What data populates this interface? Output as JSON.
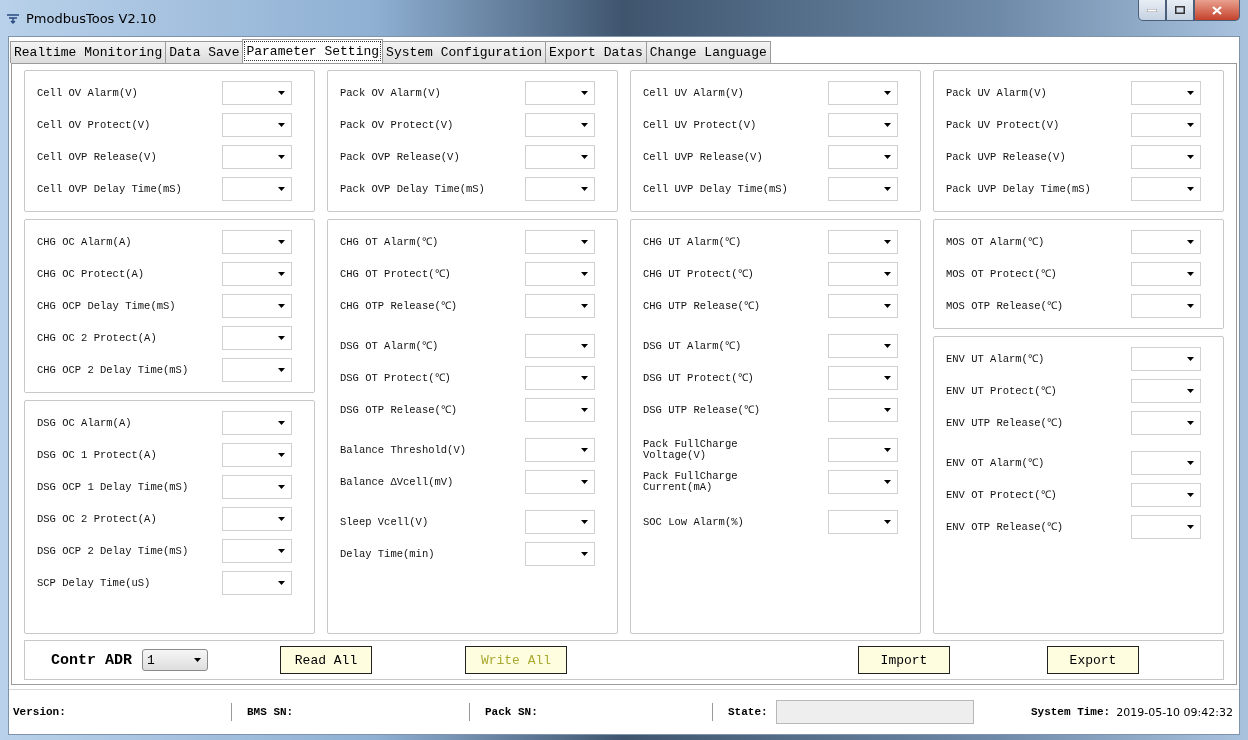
{
  "window": {
    "title": "PmodbusToos V2.10"
  },
  "tabs": [
    {
      "label": "Realtime Monitoring",
      "selected": false
    },
    {
      "label": "Data Save",
      "selected": false
    },
    {
      "label": "Parameter Setting",
      "selected": true
    },
    {
      "label": "System Configuration",
      "selected": false
    },
    {
      "label": "Export Datas",
      "selected": false
    },
    {
      "label": "Change Language",
      "selected": false
    }
  ],
  "columns": [
    {
      "groups": [
        {
          "sections": [
            [
              {
                "label": "Cell OV Alarm(V)"
              },
              {
                "label": "Cell OV Protect(V)"
              },
              {
                "label": "Cell OVP Release(V)"
              },
              {
                "label": "Cell OVP Delay Time(mS)"
              }
            ]
          ]
        },
        {
          "sections": [
            [
              {
                "label": "CHG OC Alarm(A)"
              },
              {
                "label": "CHG OC Protect(A)"
              },
              {
                "label": "CHG OCP Delay Time(mS)"
              },
              {
                "label": "CHG OC 2 Protect(A)"
              },
              {
                "label": "CHG OCP 2 Delay Time(mS)"
              }
            ]
          ]
        },
        {
          "sections": [
            [
              {
                "label": "DSG OC Alarm(A)"
              },
              {
                "label": "DSG OC 1 Protect(A)"
              },
              {
                "label": "DSG OCP 1 Delay Time(mS)"
              },
              {
                "label": "DSG OC 2 Protect(A)"
              },
              {
                "label": "DSG OCP 2 Delay Time(mS)"
              },
              {
                "label": "SCP Delay Time(uS)"
              }
            ]
          ]
        }
      ]
    },
    {
      "groups": [
        {
          "sections": [
            [
              {
                "label": "Pack OV Alarm(V)"
              },
              {
                "label": "Pack OV Protect(V)"
              },
              {
                "label": "Pack OVP Release(V)"
              },
              {
                "label": "Pack OVP Delay Time(mS)"
              }
            ]
          ]
        },
        {
          "sections": [
            [
              {
                "label": "CHG OT Alarm(℃)"
              },
              {
                "label": "CHG OT Protect(℃)"
              },
              {
                "label": "CHG OTP Release(℃)"
              }
            ],
            [
              {
                "label": "DSG OT Alarm(℃)"
              },
              {
                "label": "DSG OT Protect(℃)"
              },
              {
                "label": "DSG OTP Release(℃)"
              }
            ],
            [
              {
                "label": "Balance Threshold(V)"
              },
              {
                "label": "Balance ΔVcell(mV)"
              }
            ],
            [
              {
                "label": "Sleep Vcell(V)"
              },
              {
                "label": "Delay Time(min)"
              }
            ]
          ]
        }
      ]
    },
    {
      "groups": [
        {
          "sections": [
            [
              {
                "label": "Cell UV Alarm(V)"
              },
              {
                "label": "Cell UV Protect(V)"
              },
              {
                "label": "Cell UVP Release(V)"
              },
              {
                "label": "Cell UVP Delay Time(mS)"
              }
            ]
          ]
        },
        {
          "sections": [
            [
              {
                "label": "CHG UT Alarm(℃)"
              },
              {
                "label": "CHG UT Protect(℃)"
              },
              {
                "label": "CHG UTP Release(℃)"
              }
            ],
            [
              {
                "label": "DSG UT Alarm(℃)"
              },
              {
                "label": "DSG UT Protect(℃)"
              },
              {
                "label": "DSG UTP Release(℃)"
              }
            ],
            [
              {
                "label": "Pack FullCharge Voltage(V)"
              },
              {
                "label": "Pack FullCharge Current(mA)"
              }
            ],
            [
              {
                "label": "SOC Low Alarm(%)"
              }
            ]
          ]
        }
      ]
    },
    {
      "groups": [
        {
          "sections": [
            [
              {
                "label": "Pack UV Alarm(V)"
              },
              {
                "label": "Pack UV Protect(V)"
              },
              {
                "label": "Pack UVP Release(V)"
              },
              {
                "label": "Pack UVP Delay Time(mS)"
              }
            ]
          ]
        },
        {
          "sections": [
            [
              {
                "label": "MOS OT Alarm(℃)"
              },
              {
                "label": "MOS OT Protect(℃)"
              },
              {
                "label": "MOS OTP Release(℃)"
              }
            ]
          ]
        },
        {
          "sections": [
            [
              {
                "label": "ENV UT Alarm(℃)"
              },
              {
                "label": "ENV UT Protect(℃)"
              },
              {
                "label": "ENV UTP Release(℃)"
              }
            ],
            [
              {
                "label": "ENV OT Alarm(℃)"
              },
              {
                "label": "ENV OT Protect(℃)"
              },
              {
                "label": "ENV OTP Release(℃)"
              }
            ]
          ]
        }
      ]
    }
  ],
  "controls": {
    "address_label": "Contr ADR",
    "address_value": "1",
    "buttons": [
      {
        "label": "Read All",
        "disabled": false
      },
      {
        "label": "Write All",
        "disabled": true
      },
      {
        "label": "Import",
        "disabled": false
      },
      {
        "label": "Export",
        "disabled": false
      }
    ]
  },
  "status_bar": {
    "fields": [
      {
        "label": "Version:",
        "kind": "text"
      },
      {
        "label": "BMS SN:",
        "kind": "text"
      },
      {
        "label": "Pack SN:",
        "kind": "text"
      },
      {
        "label": "State:",
        "kind": "box"
      }
    ],
    "time_label": "System Time:",
    "time_value": "2019-05-10 09:42:32"
  }
}
